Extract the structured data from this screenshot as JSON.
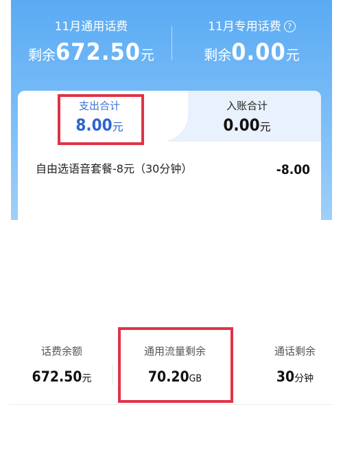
{
  "banner": {
    "general": {
      "label": "11月通用话费",
      "prefix": "剩余",
      "value": "672.50",
      "unit": "元"
    },
    "special": {
      "label": "11月专用话费",
      "prefix": "剩余",
      "value": "0.00",
      "unit": "元"
    }
  },
  "tabs": {
    "expense": {
      "label": "支出合计",
      "value": "8.00",
      "unit": "元"
    },
    "income": {
      "label": "入账合计",
      "value": "0.00",
      "unit": "元"
    }
  },
  "records": [
    {
      "name": "自由选语音套餐-8元（30分钟）",
      "amount": "-8.00"
    }
  ],
  "stats": {
    "balance": {
      "label": "话费余额",
      "value": "672.50",
      "unit": "元"
    },
    "data": {
      "label": "通用流量剩余",
      "value": "70.20",
      "unit": "GB"
    },
    "voice": {
      "label": "通话剩余",
      "value": "30",
      "unit": "分钟"
    }
  },
  "colors": {
    "banner": "#6fb6f6",
    "highlight": "#e03246",
    "accent": "#2d64d0"
  }
}
